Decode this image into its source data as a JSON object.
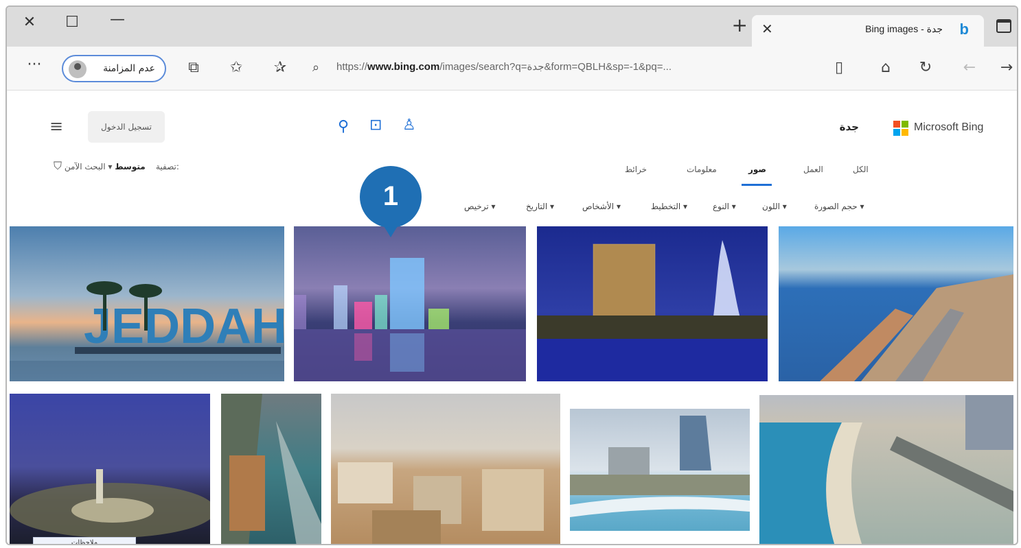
{
  "window": {
    "close_glyph": "✕",
    "maximize_glyph": "☐",
    "minimize_glyph": "—"
  },
  "tab": {
    "title": "Bing images - جدة",
    "logo": "b",
    "close_glyph": "✕",
    "new_tab_glyph": "+"
  },
  "toolbar": {
    "more_glyph": "···",
    "profile_label": "عدم المزامنة",
    "url_prefix": "https://",
    "url_domain": "www.bing.com",
    "url_rest": "/images/search?q=جدة&form=QBLH&sp=-1&pq=...",
    "home_glyph": "⌂",
    "reload_glyph": "↻",
    "back_glyph": "←",
    "forward_glyph": "→",
    "favorites_glyph": "✩",
    "collections_glyph": "⧉"
  },
  "header": {
    "brand": "Microsoft Bing",
    "query": "جدة",
    "signin_label": "تسجيل الدخول",
    "hamburger_glyph": "≡",
    "search_glyph": "🔍",
    "visual_search_glyph": "⊡",
    "mic_glyph": "🎙"
  },
  "nav": {
    "tabs": [
      "الكل",
      "صور",
      "معلومات",
      "خرائط",
      "العمل"
    ],
    "active_index": 1
  },
  "safe_search": {
    "label": "البحث الآمن:",
    "value": "متوسط",
    "filter_label": "تصفية"
  },
  "filters": [
    "حجم الصورة",
    "اللون",
    "النوع",
    "التخطيط",
    "الأشخاص",
    "التاريخ",
    "ترخيص"
  ],
  "marker": {
    "number": "1"
  },
  "thumb_caption": "ملاحظات",
  "colors": {
    "accent": "#1e6fd6",
    "marker": "#1f6fb4",
    "ms_red": "#f25022",
    "ms_green": "#7fba00",
    "ms_blue": "#00a4ef",
    "ms_yellow": "#ffb900"
  }
}
